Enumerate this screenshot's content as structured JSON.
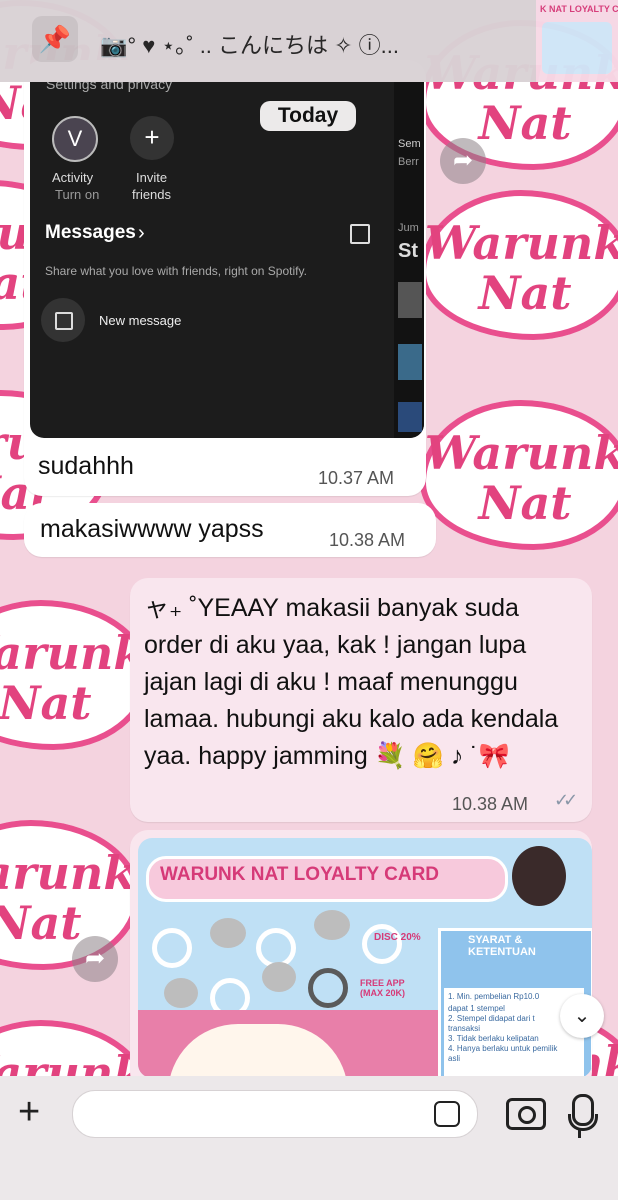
{
  "header": {
    "contact_text": "📷° ♥︎ ⋆｡˚ .. こんにちは ✧ ⓘ...",
    "thumbnail_title": "K NAT LOYALTY CARD"
  },
  "wallpaper": {
    "brand_line1": "Warunk",
    "brand_line2": "Nat"
  },
  "spotify": {
    "settings": "Settings and privacy",
    "avatar_letter": "V",
    "activity_label": "Activity",
    "activity_sub": "Turn on",
    "invite_label": "Invite",
    "invite_sub": "friends",
    "messages_title": "Messages",
    "description": "Share what you love with friends, right on Spotify.",
    "new_message": "New message",
    "side_text1": "Sem",
    "side_text2": "Berr",
    "side_text3": "Jum",
    "side_text4": "St"
  },
  "date_chip": "Today",
  "messages": [
    {
      "text": "sudahhh",
      "time": "10.37 AM"
    },
    {
      "text": "makasiwwww yapss",
      "time": "10.38 AM"
    },
    {
      "text": "ャ₊ ˚YEAAY makasii banyak suda order di aku yaa, kak ! jangan lupa jajan lagi di aku ! maaf menunggu lamaa. hubungi aku kalo ada kendala yaa. happy jamming 💐 🤗 ♪ ˙🎀",
      "time": "10.38 AM",
      "ticks": "✓✓"
    }
  ],
  "loyalty_card": {
    "title": "WARUNK NAT LOYALTY CARD",
    "disc": "DISC 20%",
    "free": "FREE APP (MAX 20K)",
    "terms_title": "SYARAT & KETENTUAN",
    "terms": [
      "1. Min. pembelian Rp10.0",
      "dapat 1 stempel",
      "2. Stempel didapat dari t",
      "transaksi",
      "3. Tidak berlaku kelipatan",
      "4. Hanya berlaku untuk pemilik",
      "asli"
    ]
  },
  "colors": {
    "wallpaper_pink": "#f4d3df",
    "brand_pink": "#e2437f",
    "sent_bubble": "#f9e6ee",
    "read_ticks": "#8a97a8"
  },
  "icons": {
    "pin": "pin-icon",
    "forward": "forward-icon",
    "plus": "plus-icon",
    "sticker": "sticker-icon",
    "camera": "camera-icon",
    "mic": "microphone-icon",
    "scroll_down": "chevron-down-icon"
  }
}
